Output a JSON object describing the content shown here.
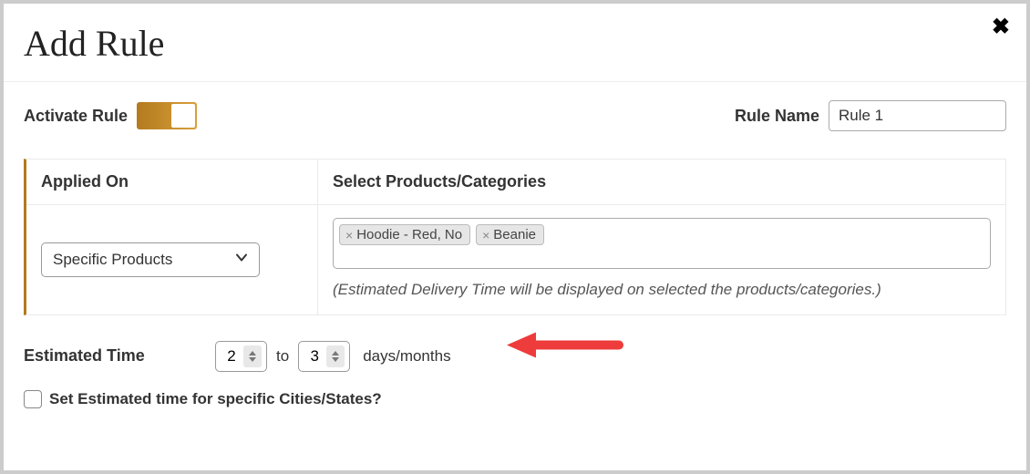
{
  "dialog": {
    "title": "Add Rule"
  },
  "activate": {
    "label": "Activate Rule",
    "on": true
  },
  "rule_name": {
    "label": "Rule Name",
    "value": "Rule 1"
  },
  "applied": {
    "header_left": "Applied On",
    "header_right": "Select Products/Categories",
    "select_value": "Specific Products",
    "tags": [
      "Hoodie - Red, No",
      "Beanie"
    ],
    "hint": "(Estimated Delivery Time will be displayed on selected the products/categories.)"
  },
  "estimated": {
    "label": "Estimated Time",
    "from": "2",
    "to_word": "to",
    "to": "3",
    "unit": "days/months"
  },
  "cities_checkbox": {
    "label": "Set Estimated time for specific Cities/States?",
    "checked": false
  },
  "colors": {
    "accent": "#b37a1f",
    "annotation": "#ee3b3b"
  }
}
